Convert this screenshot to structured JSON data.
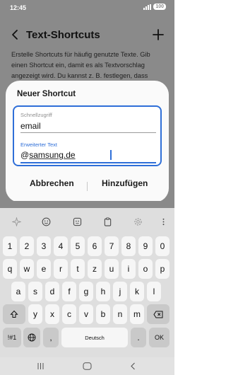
{
  "status_bar": {
    "time": "12:45",
    "battery": "100"
  },
  "app_bar": {
    "title": "Text-Shortcuts"
  },
  "description": "Erstelle Shortcuts für häufig genutzte Texte. Gib einen Shortcut ein, damit es als Textvorschlag angezeigt wird. Du kannst z. B. festlegen, dass",
  "dialog": {
    "title": "Neuer Shortcut",
    "shortcut_label": "Schnellzugriff",
    "shortcut_value": "email",
    "expanded_label": "Erweiterter Text",
    "expanded_prefix": "@",
    "expanded_word": "samsung.de",
    "cancel_label": "Abbrechen",
    "add_label": "Hinzufügen"
  },
  "keyboard": {
    "row1": [
      "1",
      "2",
      "3",
      "4",
      "5",
      "6",
      "7",
      "8",
      "9",
      "0"
    ],
    "row2": [
      "q",
      "w",
      "e",
      "r",
      "t",
      "z",
      "u",
      "i",
      "o",
      "p"
    ],
    "row3": [
      "a",
      "s",
      "d",
      "f",
      "g",
      "h",
      "j",
      "k",
      "l"
    ],
    "row4": [
      "y",
      "x",
      "c",
      "v",
      "b",
      "n",
      "m"
    ],
    "symbols_key": "!#1",
    "comma_key": ",",
    "space_key": "Deutsch",
    "period_key": ".",
    "ok_key": "OK"
  },
  "colors": {
    "accent": "#2f6fd8",
    "overlay": "#8a8a8a",
    "keyboard_bg": "#dedede"
  }
}
